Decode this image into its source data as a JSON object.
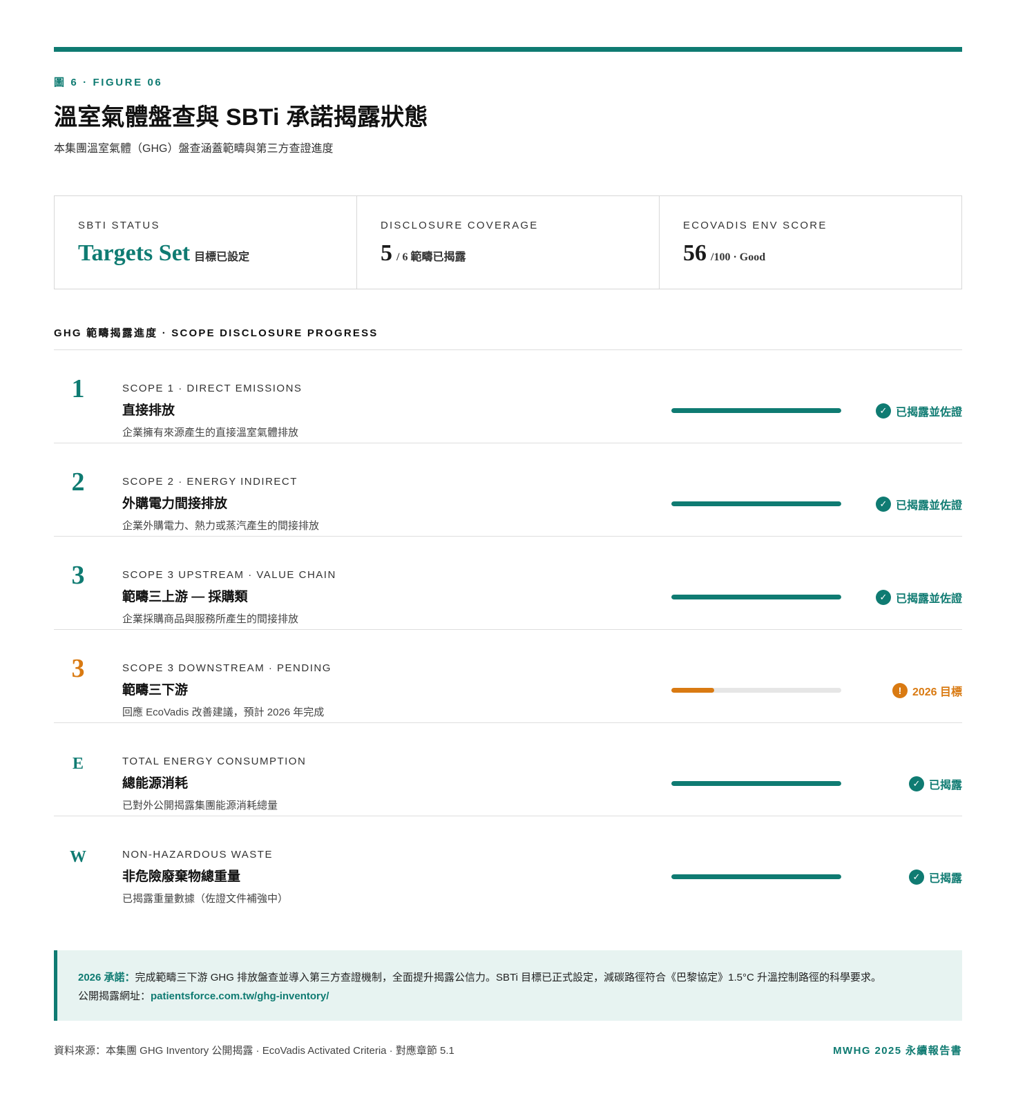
{
  "figure": {
    "label": "圖 6 · FIGURE 06",
    "title": "溫室氣體盤查與 SBTi 承諾揭露狀態",
    "subtitle": "本集團溫室氣體（GHG）盤查涵蓋範疇與第三方查證進度"
  },
  "kpis": [
    {
      "label": "SBTI STATUS",
      "value": "Targets Set",
      "suffix": "目標已設定"
    },
    {
      "label": "DISCLOSURE COVERAGE",
      "value": "5",
      "suffix": "/ 6 範疇已揭露"
    },
    {
      "label": "ECOVADIS ENV SCORE",
      "value": "56",
      "suffix": "/100 · Good"
    }
  ],
  "section": {
    "title": "GHG 範疇揭露進度 · SCOPE DISCLOSURE PROGRESS"
  },
  "rows": [
    {
      "mark": "1",
      "code": "SCOPE 1 · DIRECT EMISSIONS",
      "name": "直接排放",
      "desc": "企業擁有來源產生的直接溫室氣體排放",
      "progress": 1.0,
      "status": "已揭露並佐證",
      "status_icon": "check-icon"
    },
    {
      "mark": "2",
      "code": "SCOPE 2 · ENERGY INDIRECT",
      "name": "外購電力間接排放",
      "desc": "企業外購電力、熱力或蒸汽產生的間接排放",
      "progress": 1.0,
      "status": "已揭露並佐證",
      "status_icon": "check-icon"
    },
    {
      "mark": "3",
      "code": "SCOPE 3 UPSTREAM · VALUE CHAIN",
      "name": "範疇三上游 — 採購類",
      "desc": "企業採購商品與服務所產生的間接排放",
      "progress": 1.0,
      "status": "已揭露並佐證",
      "status_icon": "check-icon"
    },
    {
      "mark": "3",
      "code": "SCOPE 3 DOWNSTREAM · PENDING",
      "name": "範疇三下游",
      "desc": "回應 EcoVadis 改善建議，預計 2026 年完成",
      "progress": 0.25,
      "status": "2026 目標",
      "status_icon": "exclamation-icon"
    },
    {
      "mark": "E",
      "code": "TOTAL ENERGY CONSUMPTION",
      "name": "總能源消耗",
      "desc": "已對外公開揭露集團能源消耗總量",
      "progress": 1.0,
      "status": "已揭露",
      "status_icon": "check-icon"
    },
    {
      "mark": "W",
      "code": "NON-HAZARDOUS WASTE",
      "name": "非危險廢棄物總重量",
      "desc": "已揭露重量數據（佐證文件補強中）",
      "progress": 1.0,
      "status": "已揭露",
      "status_icon": "check-icon"
    }
  ],
  "note": {
    "lead": "2026 承諾：",
    "text": "完成範疇三下游 GHG 排放盤查並導入第三方查證機制，全面提升揭露公信力。SBTi 目標已正式設定，減碳路徑符合《巴黎協定》1.5°C 升溫控制路徑的科學要求。",
    "url_label": "公開揭露網址：",
    "url": "patientsforce.com.tw/ghg-inventory/"
  },
  "footer": {
    "source": "資料來源：本集團 GHG Inventory 公開揭露 · EcoVadis Activated Criteria · 對應章節 5.1",
    "brand": "MWHG 2025 永續報告書"
  },
  "colors": {
    "accent": "#0f7b72",
    "warning": "#d97a12",
    "note_bg": "#e7f3f1"
  }
}
